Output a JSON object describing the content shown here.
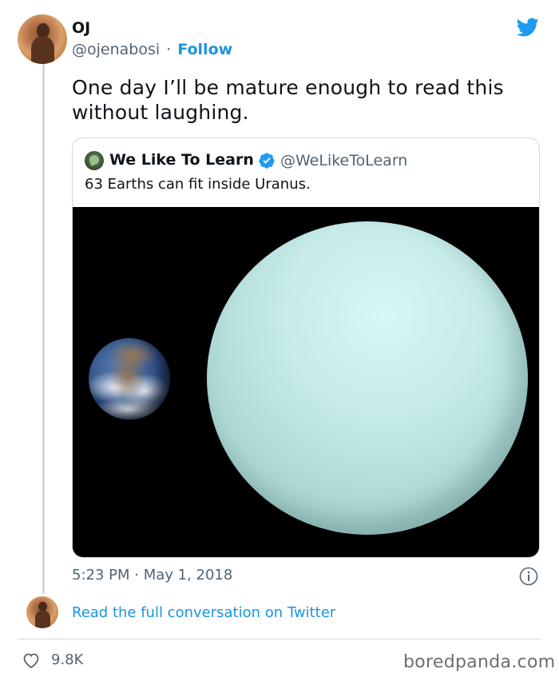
{
  "author": {
    "name": "OJ",
    "handle": "@ojenabosi",
    "separator": "·",
    "follow_label": "Follow"
  },
  "tweet": {
    "text": "One day I’ll be mature enough to read this without laughing."
  },
  "quoted_tweet": {
    "name": "We Like To Learn",
    "handle": "@WeLikeToLearn",
    "text": "63 Earths can fit inside Uranus."
  },
  "meta": {
    "timestamp": "5:23 PM · May 1, 2018"
  },
  "conversation_link": "Read the full conversation on Twitter",
  "engagement": {
    "likes": "9.8K"
  },
  "watermark": "boredpanda.com",
  "colors": {
    "link": "#1b95e0",
    "twitter_blue": "#1d9bf0",
    "muted_text": "#536471",
    "border": "#cfd9de"
  },
  "icons": [
    "twitter-bird-icon",
    "verified-badge-icon",
    "info-icon",
    "heart-icon"
  ]
}
